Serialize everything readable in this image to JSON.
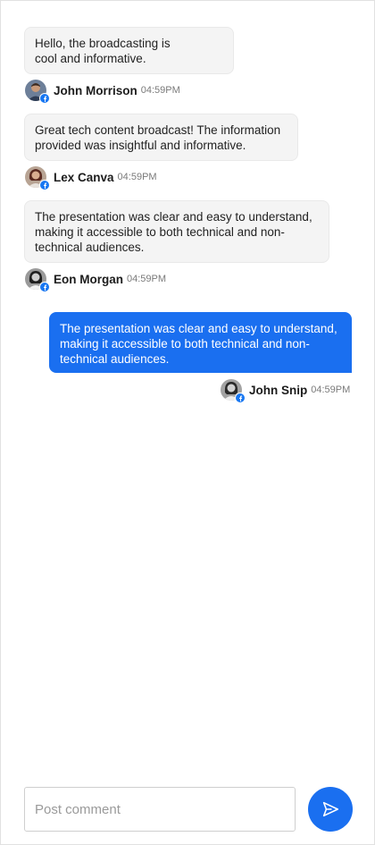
{
  "messages": [
    {
      "text": "Hello, the broadcasting is\ncool and informative.",
      "author": "John Morrison",
      "time": "04:59PM",
      "own": false,
      "avatar_icon": "user-avatar-john-morrison",
      "source_icon": "facebook-icon"
    },
    {
      "text": "Great tech content broadcast! The information\nprovided was insightful and informative.",
      "author": "Lex Canva",
      "time": "04:59PM",
      "own": false,
      "avatar_icon": "user-avatar-lex-canva",
      "source_icon": "facebook-icon"
    },
    {
      "text": "The presentation was clear and easy to understand,\nmaking it accessible to both technical and non-\ntechnical audiences.",
      "author": "Eon Morgan",
      "time": "04:59PM",
      "own": false,
      "avatar_icon": "user-avatar-eon-morgan",
      "source_icon": "facebook-icon"
    },
    {
      "text": "The presentation was clear and easy to understand,\nmaking it accessible to both technical and non-\ntechnical audiences.",
      "author": "John Snip",
      "time": "04:59PM",
      "own": true,
      "avatar_icon": "user-avatar-john-snip",
      "source_icon": "facebook-icon"
    }
  ],
  "composer": {
    "placeholder": "Post comment",
    "value": ""
  },
  "send_button": {
    "icon": "send-icon"
  },
  "colors": {
    "accent": "#1a6ff0",
    "bubble_bg": "#f4f4f4",
    "facebook": "#1877f2"
  }
}
